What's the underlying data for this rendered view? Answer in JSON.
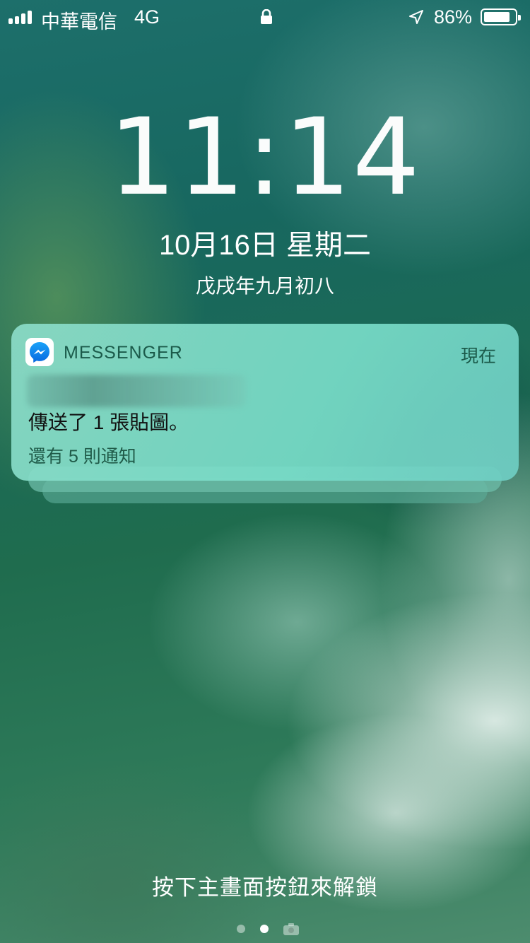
{
  "status_bar": {
    "carrier": "中華電信",
    "network": "4G",
    "battery_percent": "86%",
    "battery_level": 0.86,
    "icons": [
      "signal-bars-icon",
      "lock-icon",
      "location-arrow-icon",
      "battery-icon"
    ]
  },
  "lock_screen": {
    "time": "11:14",
    "date": "10月16日 星期二",
    "lunar_date": "戊戌年九月初八",
    "unlock_hint": "按下主畫面按鈕來解鎖"
  },
  "notification": {
    "app_name": "MESSENGER",
    "app_icon": "messenger-icon",
    "time": "現在",
    "body": "傳送了 1 張貼圖。",
    "more": "還有 5 則通知"
  },
  "page_indicator": {
    "count": 2,
    "active_index": 1,
    "trailing_icon": "camera-icon"
  },
  "colors": {
    "notification_bg": "#8cdcc8",
    "accent_text": "#1b5a4a"
  }
}
